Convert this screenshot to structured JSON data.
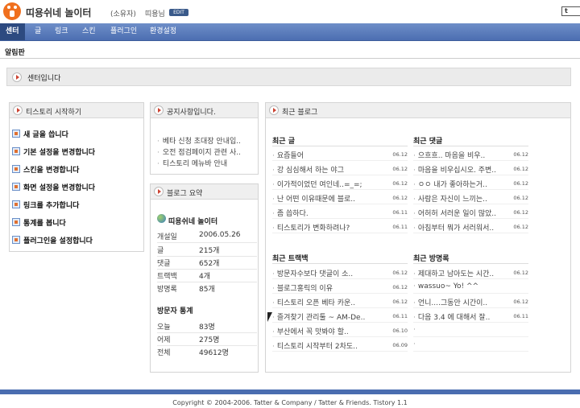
{
  "header": {
    "site_title": "띠용쉬네 놀이터",
    "role": "(소유자)",
    "user": "띠용님",
    "badge": "EDIT",
    "ext_link": "t"
  },
  "nav": {
    "items": [
      {
        "label": "센터"
      },
      {
        "label": "글"
      },
      {
        "label": "링크"
      },
      {
        "label": "스킨"
      },
      {
        "label": "플러그인"
      },
      {
        "label": "환경설정"
      }
    ]
  },
  "subnav": {
    "label": "알림판"
  },
  "center": {
    "title": "센터입니다"
  },
  "start_panel": {
    "title": "티스토리 시작하기",
    "tasks": [
      {
        "label": "새 글을 씁니다"
      },
      {
        "label": "기본 설정을 변경합니다"
      },
      {
        "label": "스킨을 변경합니다"
      },
      {
        "label": "화면 설정을 변경합니다"
      },
      {
        "label": "링크를 추가합니다"
      },
      {
        "label": "통계를 봅니다"
      },
      {
        "label": "플러그인을 설정합니다"
      }
    ]
  },
  "notice_panel": {
    "title": "공지사항입니다.",
    "items": [
      {
        "text": "베타 신청 초대장 안내입.."
      },
      {
        "text": "오전 점검페이지 관련 사.."
      },
      {
        "text": "티스토리 메뉴바 안내"
      }
    ]
  },
  "summary_panel": {
    "title": "블로그 요약",
    "blog_name": "띠용쉬네 놀이터",
    "stats": [
      {
        "label": "개설일",
        "value": "2006.05.26"
      },
      {
        "label": "글",
        "value": "215개"
      },
      {
        "label": "댓글",
        "value": "652개"
      },
      {
        "label": "트랙백",
        "value": "4개"
      },
      {
        "label": "방명록",
        "value": "85개"
      }
    ],
    "visitor_title": "방문자 통계",
    "visitors": [
      {
        "label": "오늘",
        "value": "83명"
      },
      {
        "label": "어제",
        "value": "275명"
      },
      {
        "label": "전체",
        "value": "49612명"
      }
    ]
  },
  "recent_panel": {
    "title": "최근 블로그",
    "posts": {
      "title": "최근 글",
      "items": [
        {
          "text": "요즘들어",
          "date": "06.12"
        },
        {
          "text": "강 심심해서 하는 야그",
          "date": "06.12"
        },
        {
          "text": "이가적이었던 여인네..=_=;",
          "date": "06.12"
        },
        {
          "text": "난 어떤 이유때문에 블로..",
          "date": "06.12"
        },
        {
          "text": "좀 씁하다.",
          "date": "06.11"
        },
        {
          "text": "티스토리가 변화하려나?",
          "date": "06.11"
        }
      ]
    },
    "comments": {
      "title": "최근 댓글",
      "items": [
        {
          "text": "으흐흐.. 마음을 비우..",
          "date": "06.12"
        },
        {
          "text": "마음을 비우십시오. 주변..",
          "date": "06.12"
        },
        {
          "text": "ㅇㅇ 내가 좋아하는거..",
          "date": "06.12"
        },
        {
          "text": "사람은 자신이 느끼는..",
          "date": "06.12"
        },
        {
          "text": "어허허 서러운 일이 많았..",
          "date": "06.12"
        },
        {
          "text": "아침부터 뭐가 서러워서..",
          "date": "06.12"
        }
      ]
    },
    "trackbacks": {
      "title": "최근 트랙백",
      "items": [
        {
          "text": "방문자수보다 댓글이 소..",
          "date": "06.12"
        },
        {
          "text": "블로그홍릭의 이유",
          "date": "06.12"
        },
        {
          "text": "티스토리 오픈 베타 카운..",
          "date": "06.12"
        },
        {
          "text": "즐겨찾기 관리툴 ~ AM-De..",
          "date": "06.11"
        },
        {
          "text": "부산에서 꼭 맛봐야 할..",
          "date": "06.10"
        },
        {
          "text": "티스토리 시작부터 2차도..",
          "date": "06.09"
        }
      ]
    },
    "guestbook": {
      "title": "최근 방명록",
      "items": [
        {
          "text": "제대하고 남아도는 시간..",
          "date": "06.12"
        },
        {
          "text": "wassuo~ Yo! ^^",
          "date": ""
        },
        {
          "text": "언니....그동안 시간이..",
          "date": "06.12"
        },
        {
          "text": "다음 3.4 에 대해서 잘..",
          "date": "06.11"
        },
        {
          "text": "",
          "date": ""
        },
        {
          "text": "",
          "date": ""
        }
      ]
    }
  },
  "footer": {
    "text": "Copyright © 2004-2006. Tatter & Company / Tatter & Friends. Tistory 1.1"
  },
  "colors": {
    "nav": "#4c6eb1",
    "nav_active": "#2d4a80",
    "logo": "#f0701e"
  }
}
